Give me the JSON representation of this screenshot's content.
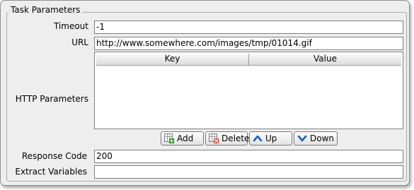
{
  "panel": {
    "title": "Task Parameters"
  },
  "fields": {
    "timeout": {
      "label": "Timeout",
      "value": "-1"
    },
    "url": {
      "label": "URL",
      "value": "http://www.somewhere.com/images/tmp/01014.gif"
    },
    "http_params": {
      "label": "HTTP Parameters"
    },
    "response_code": {
      "label": "Response Code",
      "value": "200"
    },
    "extract_variables": {
      "label": "Extract Variables",
      "value": ""
    }
  },
  "table": {
    "columns": [
      "Key",
      "Value"
    ],
    "rows": []
  },
  "buttons": {
    "add": {
      "label": "Add",
      "icon": "add-row-icon"
    },
    "delete": {
      "label": "Delete",
      "icon": "delete-row-icon"
    },
    "up": {
      "label": "Up",
      "icon": "up-arrow-icon"
    },
    "down": {
      "label": "Down",
      "icon": "down-arrow-icon"
    }
  },
  "colors": {
    "frame_bg": "#eeeeee",
    "arrow_blue": "#1a5fc8",
    "add_green": "#2f9a2f",
    "delete_red": "#d23a2a"
  }
}
